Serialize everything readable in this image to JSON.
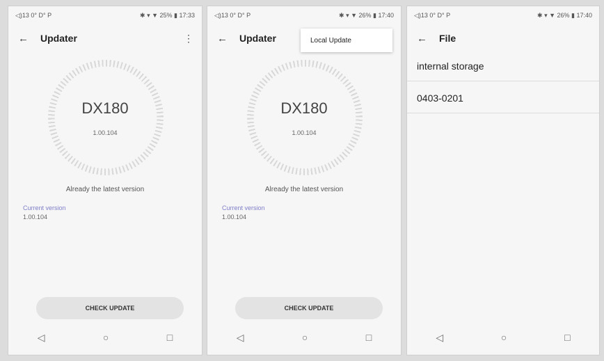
{
  "phone1": {
    "status_left": "◁)13 0° D° P",
    "status_right": "✱ ▾ ▼ 25% ▮ 17:33",
    "title": "Updater",
    "model": "DX180",
    "version": "1.00.104",
    "latest_text": "Already the latest version",
    "current_label": "Current version",
    "current_value": "1.00.104",
    "button": "CHECK UPDATE"
  },
  "phone2": {
    "status_left": "◁)13 0° D° P",
    "status_right": "✱ ▾ ▼ 26% ▮ 17:40",
    "title": "Updater",
    "menu_item": "Local Update",
    "model": "DX180",
    "version": "1.00.104",
    "latest_text": "Already the latest version",
    "current_label": "Current version",
    "current_value": "1.00.104",
    "button": "CHECK UPDATE"
  },
  "phone3": {
    "status_left": "◁)13 0° D° P",
    "status_right": "✱ ▾ ▼ 26% ▮ 17:40",
    "title": "File",
    "items": [
      "internal storage",
      "0403-0201"
    ]
  },
  "icons": {
    "back": "←",
    "more": "⋮",
    "nav_back": "◁",
    "nav_home": "○",
    "nav_recent": "□"
  }
}
